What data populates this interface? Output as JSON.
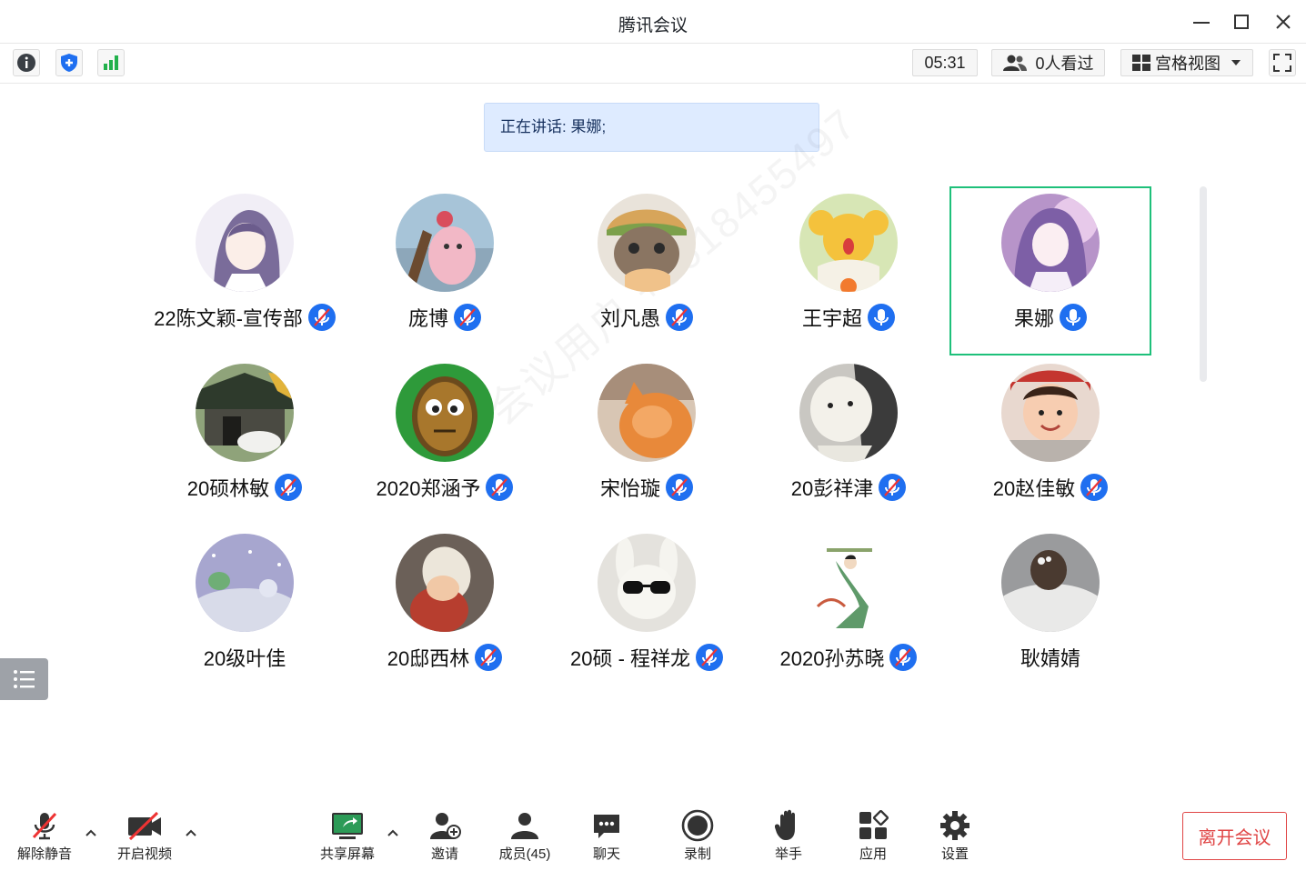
{
  "window": {
    "title": "腾讯会议"
  },
  "toolbar": {
    "timer": "05:31",
    "viewers": "0人看过",
    "view_mode": "宫格视图"
  },
  "speaking_banner": "正在讲话: 果娜;",
  "watermark": "会议用户 +8618455497",
  "participants": [
    {
      "name": "22陈文颖-宣传部",
      "mic": "muted"
    },
    {
      "name": "庞博",
      "mic": "muted"
    },
    {
      "name": "刘凡愚",
      "mic": "muted"
    },
    {
      "name": "王宇超",
      "mic": "on"
    },
    {
      "name": "果娜",
      "mic": "on",
      "active": true
    },
    {
      "name": "20硕林敏",
      "mic": "muted"
    },
    {
      "name": "2020郑涵予",
      "mic": "muted"
    },
    {
      "name": "宋怡璇",
      "mic": "muted"
    },
    {
      "name": "20彭祥津",
      "mic": "muted"
    },
    {
      "name": "20赵佳敏",
      "mic": "muted"
    },
    {
      "name": "20级叶佳",
      "mic": "none"
    },
    {
      "name": "20邸西林",
      "mic": "muted"
    },
    {
      "name": "20硕 - 程祥龙",
      "mic": "muted"
    },
    {
      "name": "2020孙苏晓",
      "mic": "muted"
    },
    {
      "name": "耿婧婧",
      "mic": "none"
    }
  ],
  "bottombar": {
    "unmute": "解除静音",
    "start_video": "开启视频",
    "share_screen": "共享屏幕",
    "invite": "邀请",
    "members": "成员(45)",
    "chat": "聊天",
    "record": "录制",
    "raise_hand": "举手",
    "apps": "应用",
    "settings": "设置",
    "leave": "离开会议"
  },
  "colors": {
    "accent_blue": "#1f6ff0",
    "active_border": "#1ec07a",
    "leave_red": "#e04646",
    "banner_bg": "#deebff"
  }
}
